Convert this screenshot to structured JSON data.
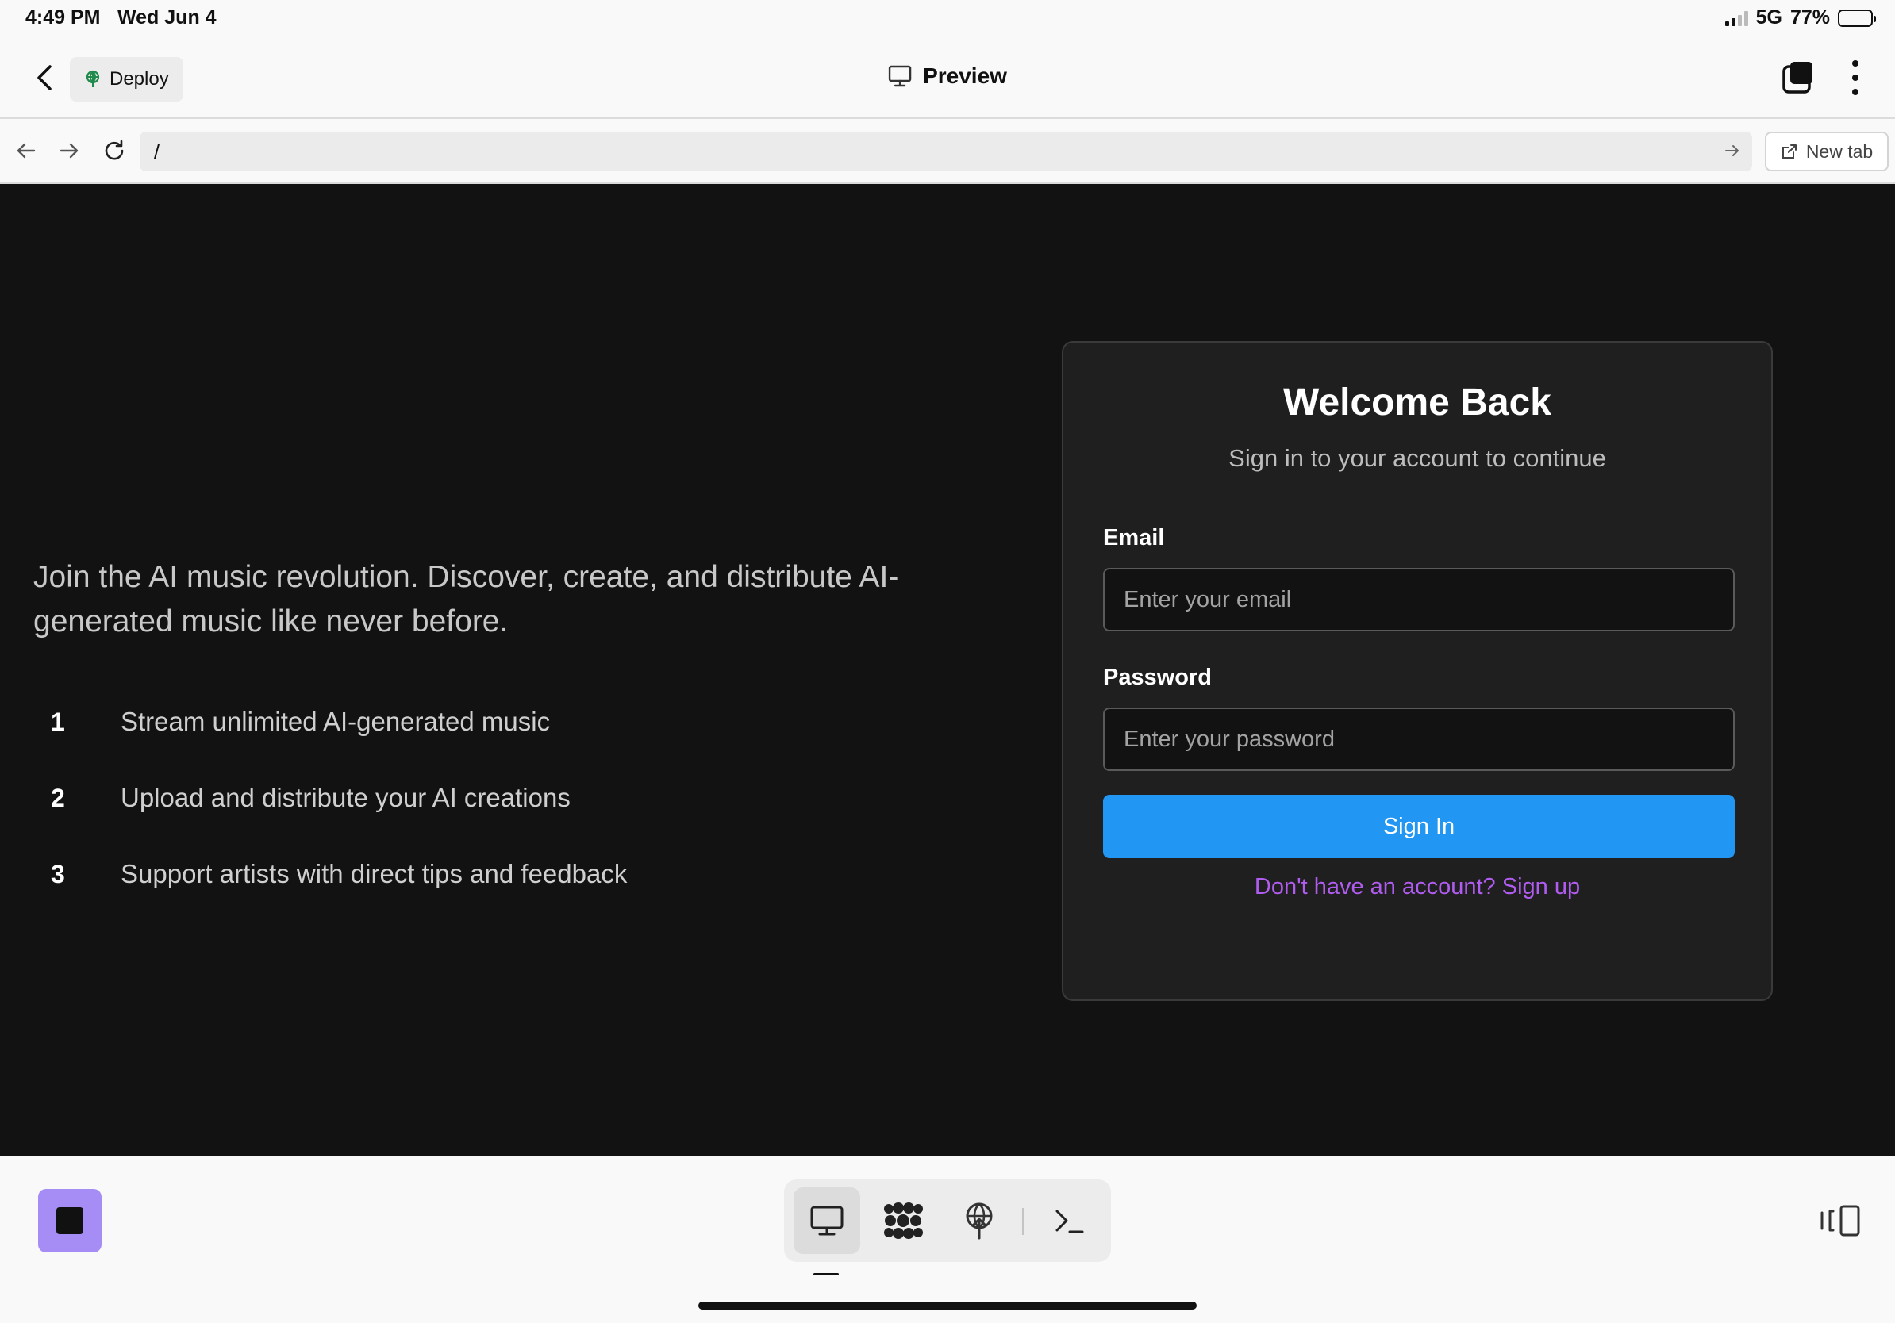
{
  "status_bar": {
    "time": "4:49 PM",
    "date": "Wed Jun 4",
    "network": "5G",
    "battery": "77%",
    "battery_level": 0.77
  },
  "header": {
    "back_icon": "chevron-left-icon",
    "deploy_label": "Deploy",
    "title": "Preview",
    "title_icon": "monitor-icon"
  },
  "urlbar": {
    "url": "/",
    "new_tab_label": "New tab"
  },
  "page": {
    "intro": "Join the AI music revolution. Discover, create, and distribute AI-generated music like never before.",
    "features": [
      {
        "num": "1",
        "text": "Stream unlimited AI-generated music"
      },
      {
        "num": "2",
        "text": "Upload and distribute your AI creations"
      },
      {
        "num": "3",
        "text": "Support artists with direct tips and feedback"
      }
    ],
    "login": {
      "title": "Welcome Back",
      "subtitle": "Sign in to your account to continue",
      "email_label": "Email",
      "email_placeholder": "Enter your email",
      "email_value": "",
      "password_label": "Password",
      "password_placeholder": "Enter your password",
      "password_value": "",
      "submit_label": "Sign In",
      "signup_link": "Don't have an account? Sign up"
    }
  },
  "colors": {
    "page_bg": "#121212",
    "card_bg": "#1f1f1f",
    "primary_button": "#2196f3",
    "link": "#b05cf0",
    "stop_button": "#a58df5"
  },
  "toolbar": {
    "items": [
      "monitor-icon",
      "packages-icon",
      "deploy-icon",
      "terminal-icon"
    ],
    "active": "monitor-icon"
  }
}
